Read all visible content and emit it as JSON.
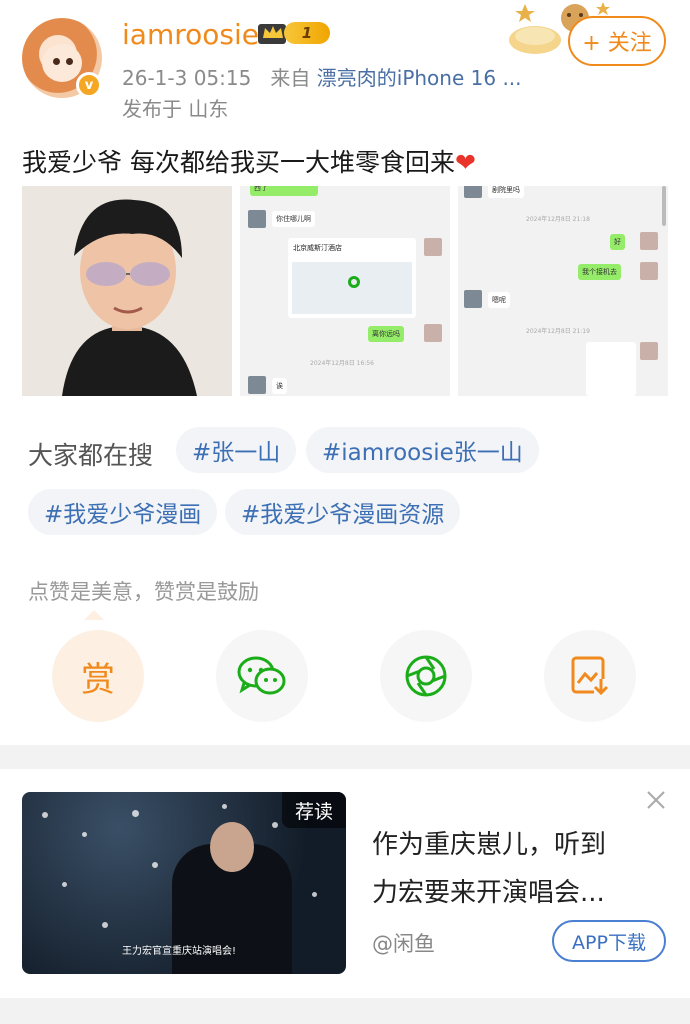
{
  "post": {
    "username": "iamroosie",
    "vip_level": "1",
    "time": "26-1-3 05:15",
    "from_prefix": "来自",
    "source": "漂亮肉的iPhone 16 ...",
    "location": "发布于 山东",
    "follow_label": "+ 关注",
    "text": "我爱少爷 每次都给我买一大堆零食回来",
    "heart": "❤",
    "verify_mark": "v"
  },
  "chat_images": {
    "img2": {
      "top_bubble": "西了",
      "msg1": "你住哪儿啊",
      "map_title": "北京威斯汀酒店",
      "msg2": "离你远吗",
      "time1": "2024年12月8日 16:56",
      "msg3": "诶"
    },
    "img3": {
      "top_msg": "剧院里吗",
      "time1": "2024年12月8日 21:18",
      "msg1": "好",
      "msg2": "我个接机去",
      "msg3": "嗯呢",
      "time2": "2024年12月8日 21:19"
    }
  },
  "search": {
    "label": "大家都在搜",
    "tags": [
      "#张一山",
      "#iamroosie张一山",
      "#我爱少爷漫画",
      "#我爱少爷漫画资源"
    ]
  },
  "reward": {
    "text": "点赞是美意，赞赏是鼓励",
    "reward_label": "赏"
  },
  "ad": {
    "badge": "荐读",
    "title_line1": "作为重庆崽儿，听到",
    "title_line2": "力宏要来开演唱会...",
    "source": "@闲鱼",
    "button": "APP下载",
    "caption": "王力宏官宣重庆站演唱会!"
  },
  "colors": {
    "accent": "#f08a1c",
    "link": "#3d6fb5",
    "wechat_green": "#1aad19"
  }
}
